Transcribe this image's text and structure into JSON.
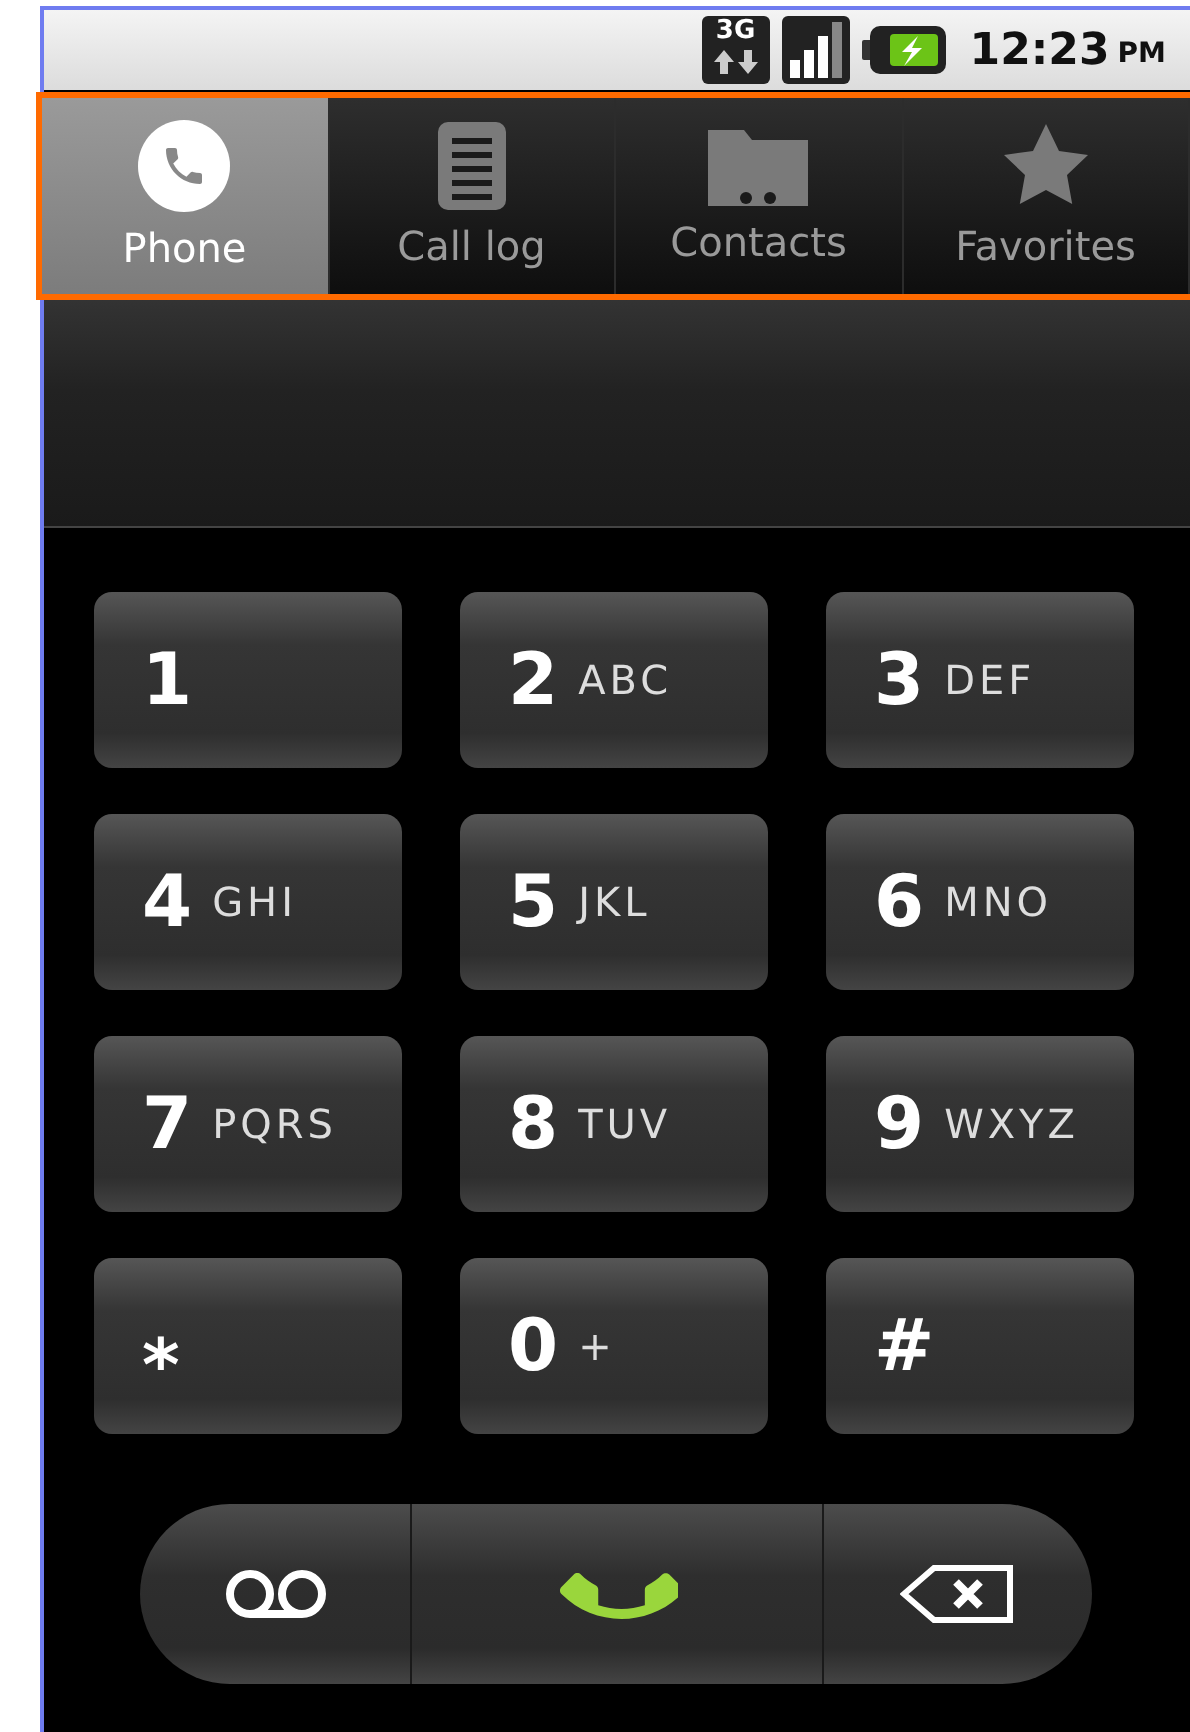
{
  "status_bar": {
    "network_type": "3G",
    "time": "12:23",
    "meridiem": "PM"
  },
  "tab_bar": {
    "highlighted": true,
    "tabs": [
      {
        "kind": "phone",
        "label": "Phone",
        "selected": true
      },
      {
        "kind": "call_log",
        "label": "Call log",
        "selected": false
      },
      {
        "kind": "contacts",
        "label": "Contacts",
        "selected": false
      },
      {
        "kind": "favorites",
        "label": "Favorites",
        "selected": false
      }
    ]
  },
  "keypad": [
    {
      "digit": "1"
    },
    {
      "digit": "2",
      "letters": "ABC"
    },
    {
      "digit": "3",
      "letters": "DEF"
    },
    {
      "digit": "4",
      "letters": "GHI"
    },
    {
      "digit": "5",
      "letters": "JKL"
    },
    {
      "digit": "6",
      "letters": "MNO"
    },
    {
      "digit": "7",
      "letters": "PQRS"
    },
    {
      "digit": "8",
      "letters": "TUV"
    },
    {
      "digit": "9",
      "letters": "WXYZ"
    },
    {
      "digit": "⁎"
    },
    {
      "digit": "0",
      "letters": "+"
    },
    {
      "digit": "#"
    }
  ],
  "actions": [
    {
      "kind": "voicemail"
    },
    {
      "kind": "call"
    },
    {
      "kind": "delete"
    }
  ]
}
